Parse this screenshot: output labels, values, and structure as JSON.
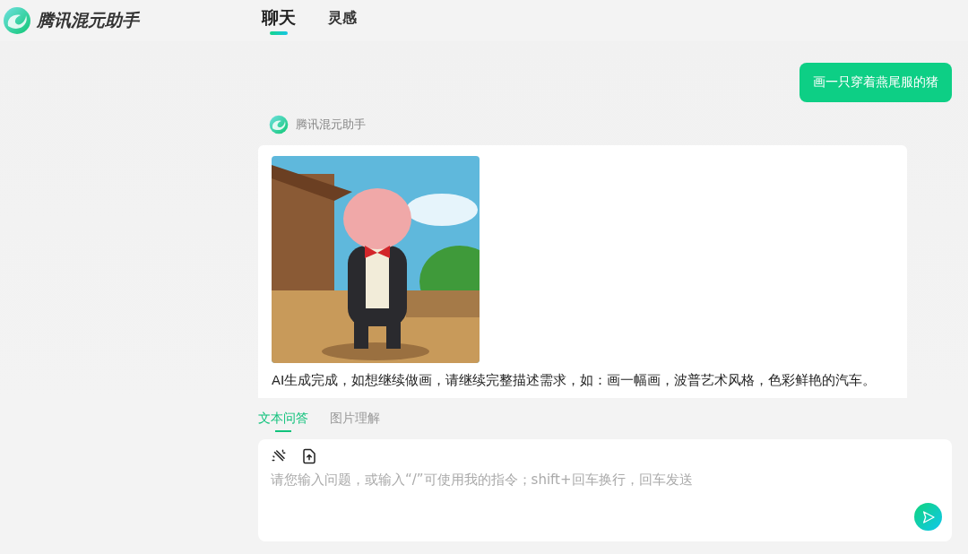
{
  "header": {
    "brand": "腾讯混元助手",
    "tabs": [
      {
        "label": "聊天",
        "selected": true
      },
      {
        "label": "灵感",
        "selected": false
      }
    ]
  },
  "messages": [
    {
      "kind": "user",
      "text": "画一只穿着燕尾服的猪"
    },
    {
      "kind": "bot",
      "sender": "腾讯混元助手",
      "text": "AI生成完成，如想继续做画，请继续完整描述需求，如：画一幅画，波普艺术风格，色彩鲜艳的汽车。"
    }
  ],
  "mode_tabs": [
    {
      "label": "文本问答",
      "selected": true
    },
    {
      "label": "图片理解",
      "selected": false
    }
  ],
  "composer": {
    "placeholder": "请您输入问题，或输入“/”可使用我的指令；shift+回车换行，回车发送"
  }
}
